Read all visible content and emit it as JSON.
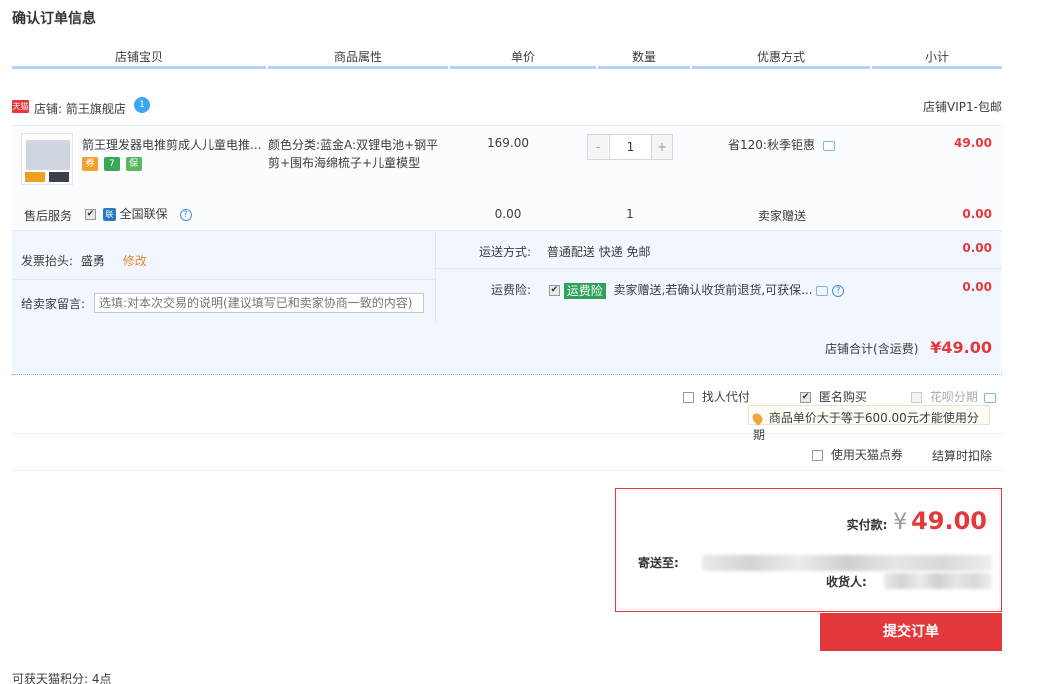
{
  "title": "确认订单信息",
  "columns": [
    "店铺宝贝",
    "商品属性",
    "单价",
    "数量",
    "优惠方式",
    "小计"
  ],
  "shop": {
    "badge": "天猫",
    "label": "店铺:",
    "name": "箭王旗舰店",
    "ww_icon": "1",
    "vip": "店铺VIP1-包邮"
  },
  "item": {
    "title": "箭王理发器电推剪成人儿童电推...",
    "attr_line1": "颜色分类:蓝金A:双锂电池+钢平",
    "attr_line2": "剪+围布海绵梳子+儿童模型",
    "price": "169.00",
    "qty": "1",
    "minus": "-",
    "plus": "+",
    "discount": "省120:秋季钜惠",
    "subtotal": "49.00",
    "tags": [
      "券",
      "7",
      "保"
    ]
  },
  "service": {
    "label": "售后服务",
    "lian": "联",
    "name": "全国联保",
    "price": "0.00",
    "qty": "1",
    "method": "卖家赠送",
    "subtotal": "0.00"
  },
  "invoice": {
    "label": "发票抬头:",
    "value": "盛勇",
    "edit": "修改"
  },
  "message": {
    "label": "给卖家留言:",
    "placeholder": "选填:对本次交易的说明(建议填写已和卖家协商一致的内容)"
  },
  "shipping": {
    "label": "运送方式:",
    "value": "普通配送 快递 免邮",
    "price": "0.00"
  },
  "insurance": {
    "label": "运费险:",
    "tag": "运费险",
    "text": "卖家赠送,若确认收货前退货,可获保...",
    "price": "0.00"
  },
  "shop_total": {
    "label": "店铺合计(含运费)",
    "value": "¥49.00"
  },
  "options": {
    "proxy": "找人代付",
    "anonymous": "匿名购买",
    "huabei": "花呗分期",
    "tip": "商品单价大于等于600.00元才能使用分期",
    "tmall_points": "使用天猫点券",
    "deduct": "结算时扣除"
  },
  "pay": {
    "label": "实付款:",
    "currency": "¥",
    "amount": "49.00",
    "ship_to": "寄送至:",
    "receiver": "收货人:"
  },
  "submit": "提交订单",
  "points": "可获天猫积分: 4点",
  "colors": {
    "accent": "#e4393c",
    "header_line": "#b2d1ff",
    "light_bg": "#f2f7ff"
  }
}
